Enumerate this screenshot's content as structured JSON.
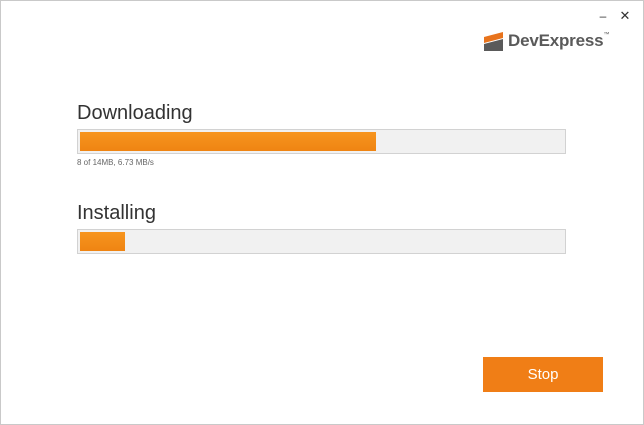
{
  "window": {
    "controls": {
      "minimize_glyph": "–",
      "close_glyph": "✕"
    }
  },
  "logo": {
    "text": "DevExpress",
    "trademark": "™",
    "icon": "devexpress-logo-icon",
    "colors": {
      "mark": "#e8731c",
      "text": "#5a5a5a"
    }
  },
  "download": {
    "title": "Downloading",
    "status": "8 of 14MB, 6.73 MB/s",
    "progress_fraction": 0.6
  },
  "install": {
    "title": "Installing",
    "progress_fraction": 0.09
  },
  "actions": {
    "stop_label": "Stop"
  },
  "colors": {
    "accent": "#f07e16",
    "progress_fill": "#f28a18",
    "track": "#f1f1f1"
  }
}
